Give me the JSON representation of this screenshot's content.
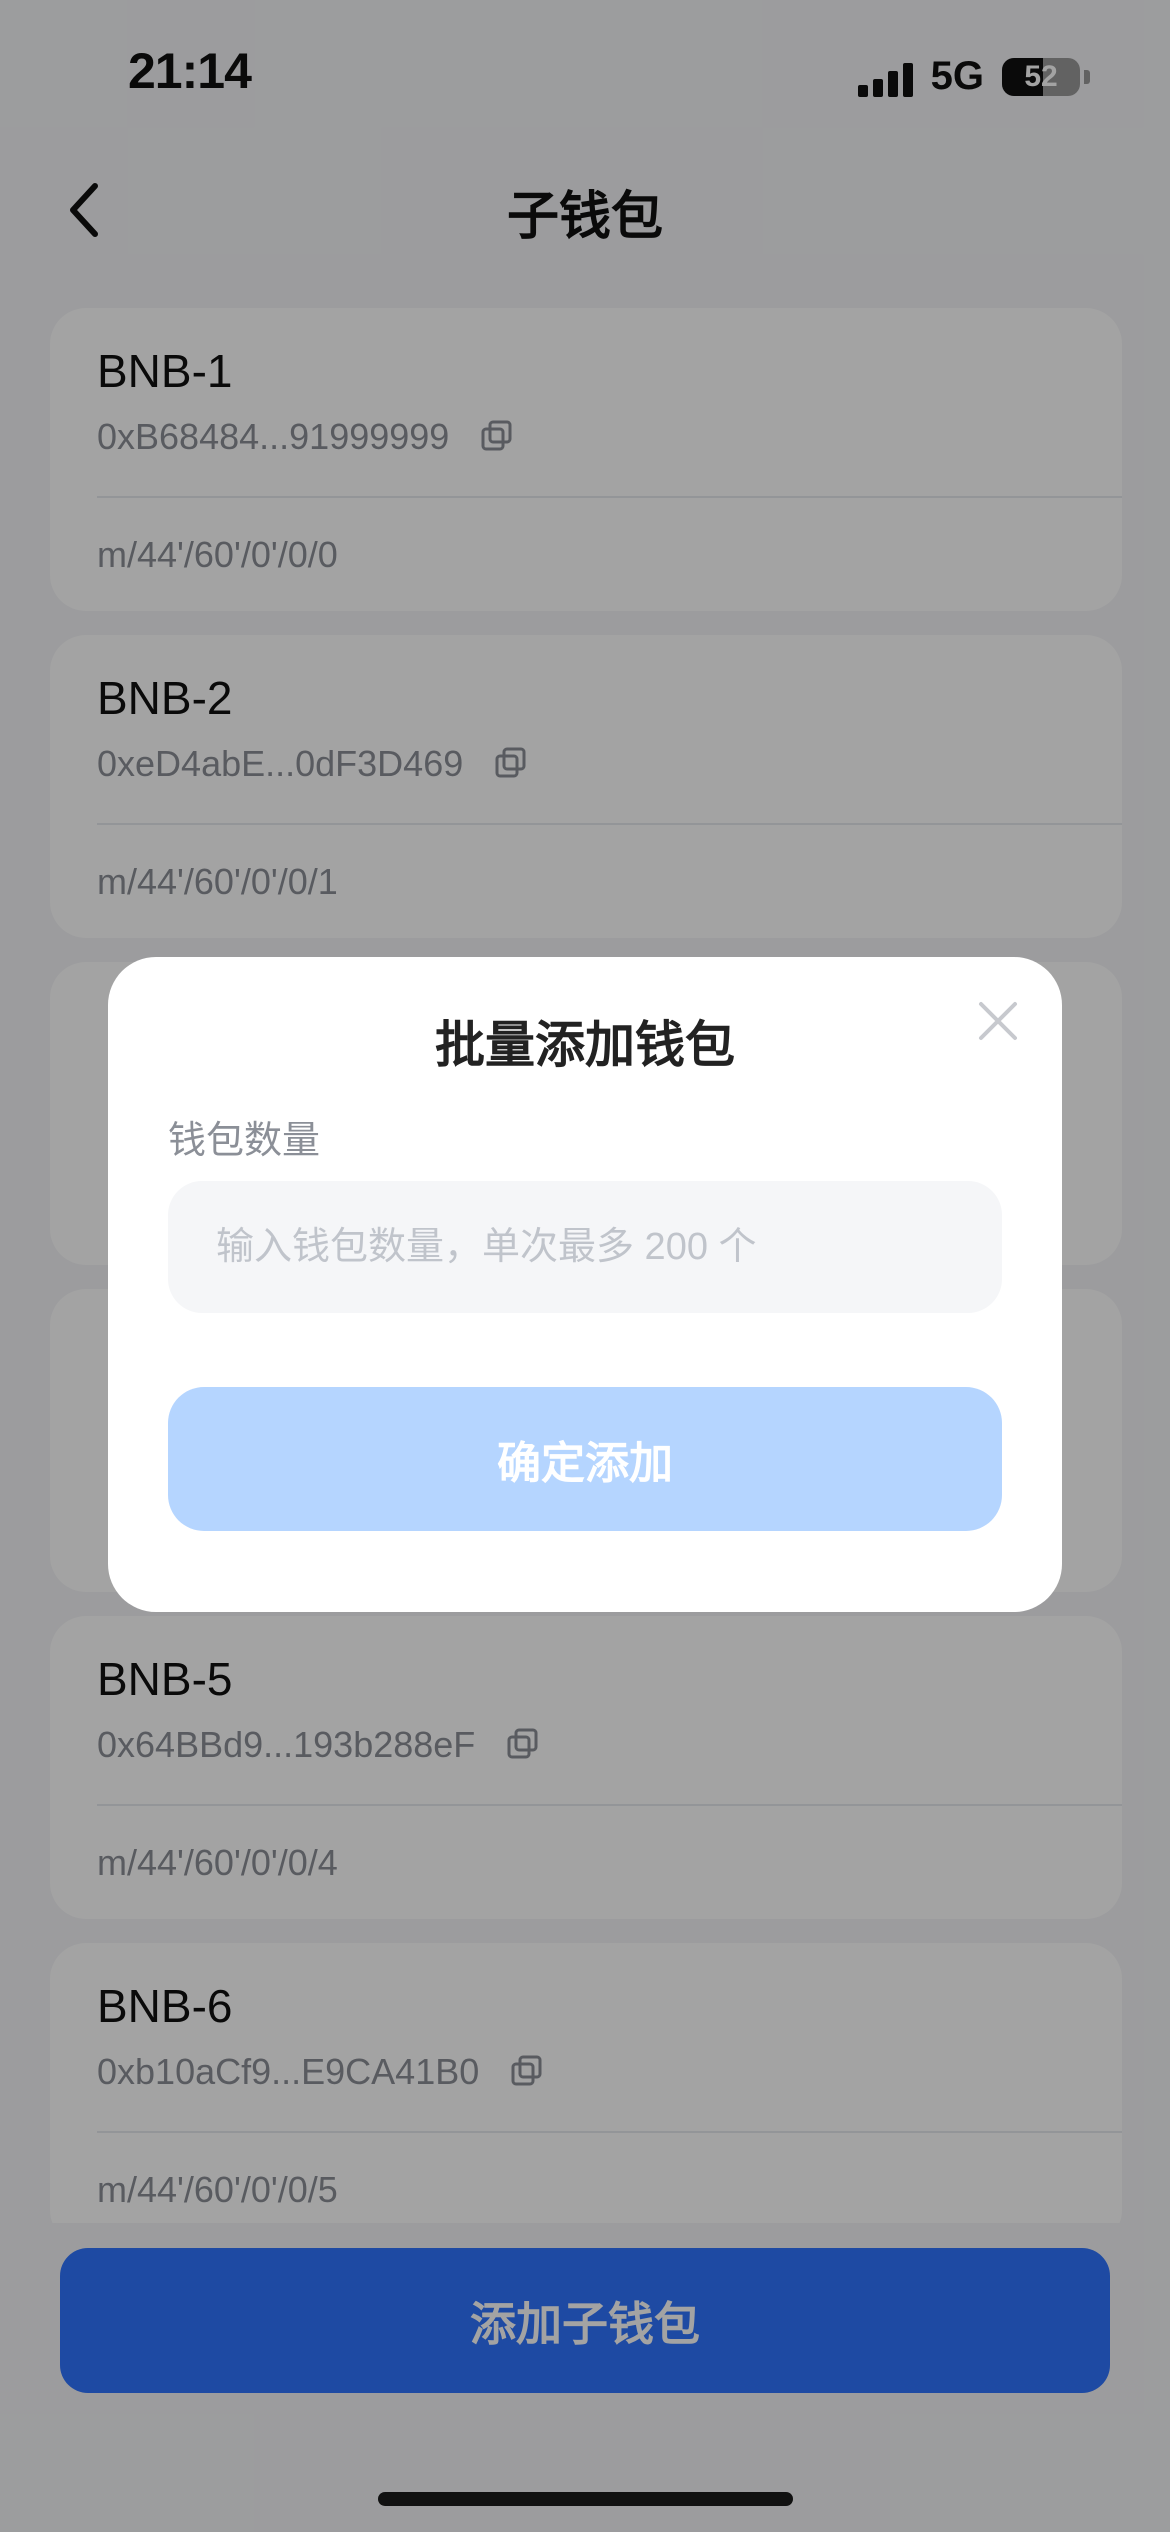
{
  "status_bar": {
    "time": "21:14",
    "network": "5G",
    "battery": {
      "level": 52,
      "text": "52"
    }
  },
  "header": {
    "title": "子钱包",
    "back_icon": "chevron-left-icon"
  },
  "wallets": [
    {
      "name": "BNB-1",
      "address": "0xB68484...91999999",
      "path": "m/44'/60'/0'/0/0"
    },
    {
      "name": "BNB-2",
      "address": "0xeD4abE...0dF3D469",
      "path": "m/44'/60'/0'/0/1"
    },
    {
      "name": "BNB-5",
      "address": "0x64BBd9...193b288eF",
      "path": "m/44'/60'/0'/0/4"
    },
    {
      "name": "BNB-6",
      "address": "0xb10aCf9...E9CA41B0",
      "path": "m/44'/60'/0'/0/5"
    }
  ],
  "bottom_action": {
    "label": "添加子钱包"
  },
  "modal": {
    "title": "批量添加钱包",
    "field_label": "钱包数量",
    "placeholder": "输入钱包数量，单次最多 200 个",
    "confirm_label": "确定添加",
    "close_icon": "close-icon"
  },
  "colors": {
    "primary": "#2f74ff",
    "disabled_primary": "#b5d5ff",
    "page_bg": "#f4f5f7",
    "card_bg": "#ffffff",
    "text_secondary": "#8b8f97"
  }
}
